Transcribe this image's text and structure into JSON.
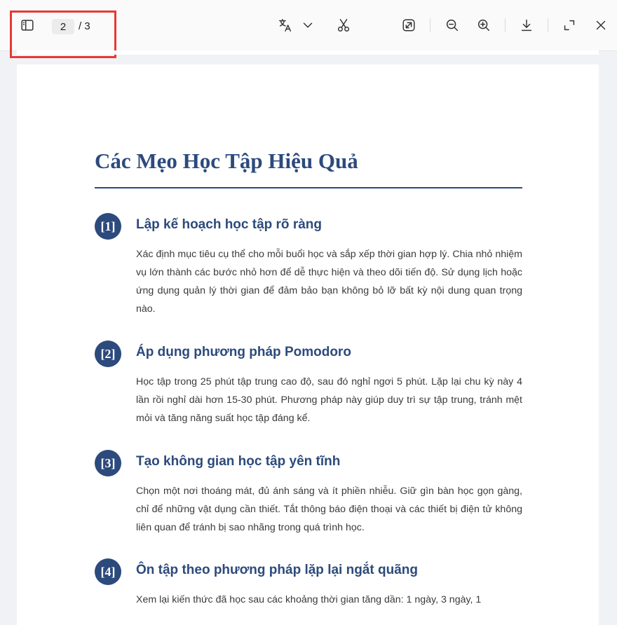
{
  "toolbar": {
    "current_page": "2",
    "page_total": "/ 3",
    "icons": [
      "sidebar-icon",
      "translate-icon",
      "chevron-down-icon",
      "scissors-icon",
      "open-external-icon",
      "zoom-out-icon",
      "zoom-in-icon",
      "download-icon",
      "fullscreen-icon",
      "close-icon"
    ]
  },
  "highlight_color": "#e53935",
  "accent_color": "#2c4a7c",
  "document": {
    "title": "Các Mẹo Học Tập Hiệu Quả",
    "tips": [
      {
        "num": "[1]",
        "heading": "Lập kế hoạch học tập rõ ràng",
        "body": "Xác định mục tiêu cụ thể cho mỗi buổi học và sắp xếp thời gian hợp lý. Chia nhỏ nhiệm vụ lớn thành các bước nhỏ hơn để dễ thực hiện và theo dõi tiến độ. Sử dụng lịch hoặc ứng dụng quản lý thời gian để đảm bảo bạn không bỏ lỡ bất kỳ nội dung quan trọng nào."
      },
      {
        "num": "[2]",
        "heading": "Áp dụng phương pháp Pomodoro",
        "body": "Học tập trong 25 phút tập trung cao độ, sau đó nghỉ ngơi 5 phút. Lặp lại chu kỳ này 4 lần rồi nghỉ dài hơn 15-30 phút. Phương pháp này giúp duy trì sự tập trung, tránh mệt mỏi và tăng năng suất học tập đáng kể."
      },
      {
        "num": "[3]",
        "heading": "Tạo không gian học tập yên tĩnh",
        "body": "Chọn một nơi thoáng mát, đủ ánh sáng và ít phiền nhiễu. Giữ gìn bàn học gọn gàng, chỉ để những vật dụng cần thiết. Tắt thông báo điện thoại và các thiết bị điện tử không liên quan để tránh bị sao nhãng trong quá trình học."
      },
      {
        "num": "[4]",
        "heading": "Ôn tập theo phương pháp lặp lại ngắt quãng",
        "body": "Xem lại kiến thức đã học sau các khoảng thời gian tăng dần: 1 ngày, 3 ngày, 1"
      }
    ]
  }
}
